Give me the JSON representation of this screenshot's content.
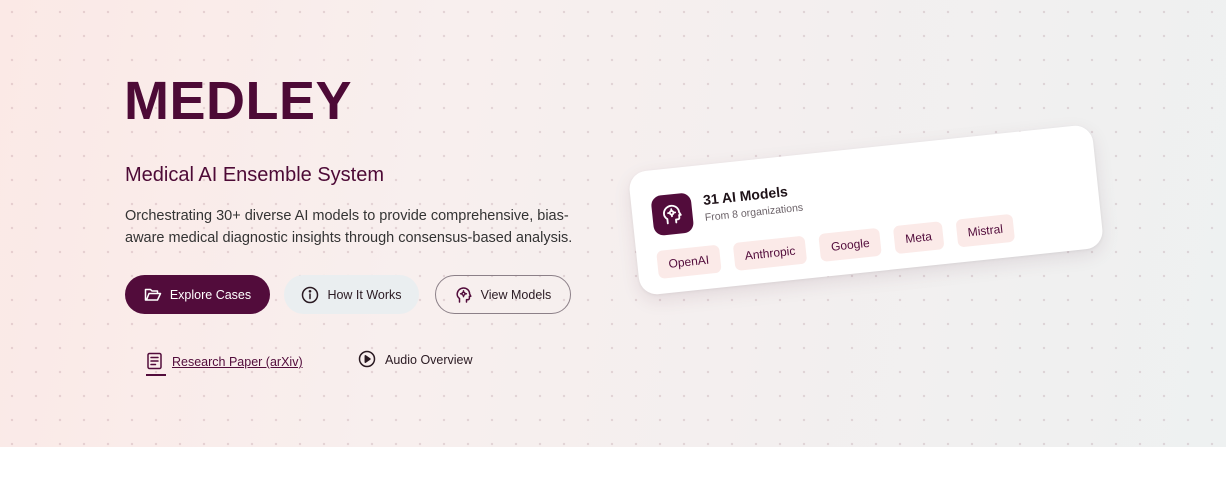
{
  "hero": {
    "title": "MEDLEY",
    "subtitle": "Medical AI Ensemble System",
    "description": "Orchestrating 30+ diverse AI models to provide comprehensive, bias-aware medical diagnostic insights through consensus-based analysis."
  },
  "buttons": {
    "explore": {
      "label": "Explore Cases",
      "icon": "folder-open-icon"
    },
    "how": {
      "label": "How It Works",
      "icon": "info-circle-icon"
    },
    "models": {
      "label": "View Models",
      "icon": "brain-gear-icon"
    }
  },
  "links": {
    "paper": {
      "label": "Research Paper (arXiv)",
      "icon": "document-icon"
    },
    "audio": {
      "label": "Audio Overview",
      "icon": "play-circle-icon"
    }
  },
  "card": {
    "title": "31 AI Models",
    "subtitle": "From 8 organizations",
    "icon": "brain-gear-icon",
    "chips": [
      "OpenAI",
      "Anthropic",
      "Google",
      "Meta",
      "Mistral"
    ]
  },
  "colors": {
    "brand": "#520c3b",
    "chip_bg": "#fbeae8"
  }
}
